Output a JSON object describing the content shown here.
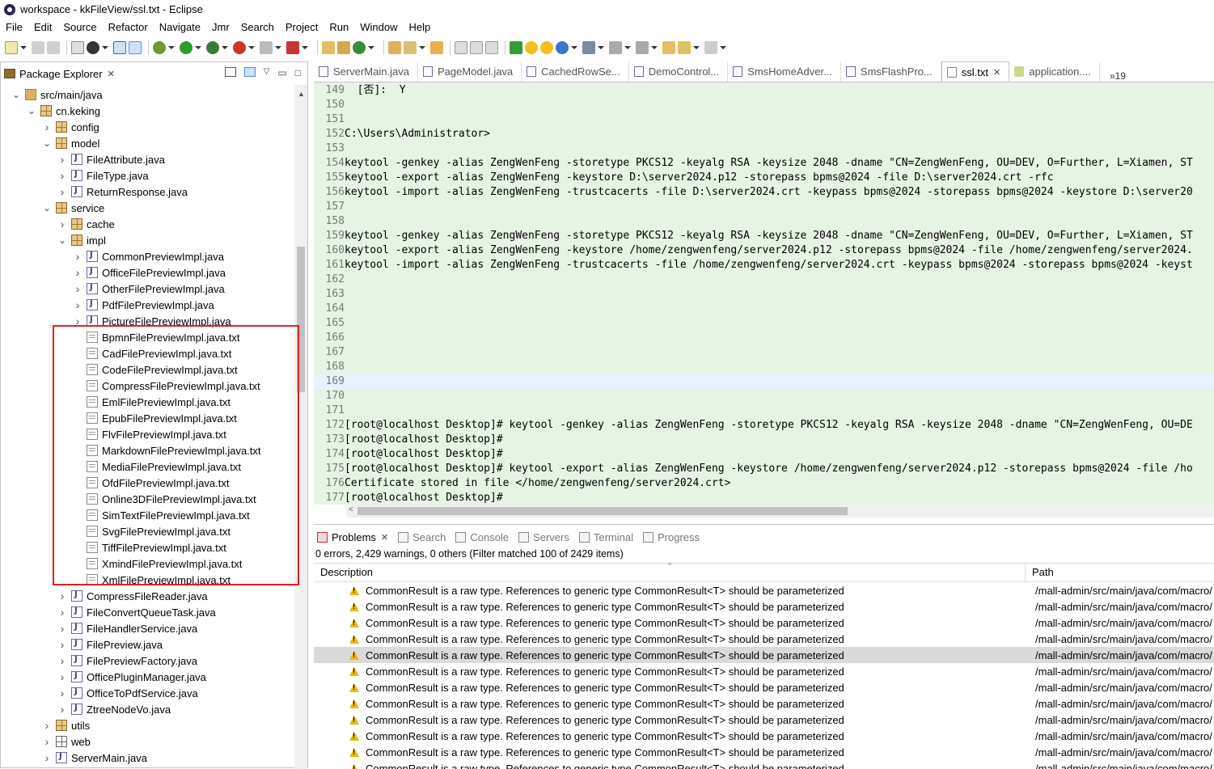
{
  "window": {
    "title": "workspace - kkFileView/ssl.txt - Eclipse"
  },
  "menu": [
    "File",
    "Edit",
    "Source",
    "Refactor",
    "Navigate",
    "Jmr",
    "Search",
    "Project",
    "Run",
    "Window",
    "Help"
  ],
  "explorer": {
    "title": "Package Explorer",
    "tree": [
      {
        "depth": 1,
        "expanded": true,
        "icon": "folder",
        "label": "src/main/java"
      },
      {
        "depth": 2,
        "expanded": true,
        "icon": "pkg",
        "label": "cn.keking"
      },
      {
        "depth": 3,
        "expanded": false,
        "icon": "pkg",
        "label": "config"
      },
      {
        "depth": 3,
        "expanded": true,
        "icon": "pkg",
        "label": "model"
      },
      {
        "depth": 4,
        "expanded": false,
        "icon": "java",
        "label": "FileAttribute.java"
      },
      {
        "depth": 4,
        "expanded": false,
        "icon": "java",
        "label": "FileType.java"
      },
      {
        "depth": 4,
        "expanded": false,
        "icon": "java",
        "label": "ReturnResponse.java"
      },
      {
        "depth": 3,
        "expanded": true,
        "icon": "pkg",
        "label": "service"
      },
      {
        "depth": 4,
        "expanded": false,
        "icon": "pkg",
        "label": "cache"
      },
      {
        "depth": 4,
        "expanded": true,
        "icon": "pkg",
        "label": "impl"
      },
      {
        "depth": 5,
        "expanded": false,
        "icon": "java",
        "label": "CommonPreviewImpl.java"
      },
      {
        "depth": 5,
        "expanded": false,
        "icon": "java",
        "label": "OfficeFilePreviewImpl.java"
      },
      {
        "depth": 5,
        "expanded": false,
        "icon": "java",
        "label": "OtherFilePreviewImpl.java"
      },
      {
        "depth": 5,
        "expanded": false,
        "icon": "java",
        "label": "PdfFilePreviewImpl.java"
      },
      {
        "depth": 5,
        "expanded": false,
        "icon": "java",
        "label": "PictureFilePreviewImpl.java"
      },
      {
        "depth": 5,
        "leaf": true,
        "icon": "txt",
        "label": "BpmnFilePreviewImpl.java.txt"
      },
      {
        "depth": 5,
        "leaf": true,
        "icon": "txt",
        "label": "CadFilePreviewImpl.java.txt"
      },
      {
        "depth": 5,
        "leaf": true,
        "icon": "txt",
        "label": "CodeFilePreviewImpl.java.txt"
      },
      {
        "depth": 5,
        "leaf": true,
        "icon": "txt",
        "label": "CompressFilePreviewImpl.java.txt"
      },
      {
        "depth": 5,
        "leaf": true,
        "icon": "txt",
        "label": "EmlFilePreviewImpl.java.txt"
      },
      {
        "depth": 5,
        "leaf": true,
        "icon": "txt",
        "label": "EpubFilePreviewImpl.java.txt"
      },
      {
        "depth": 5,
        "leaf": true,
        "icon": "txt",
        "label": "FlvFilePreviewImpl.java.txt"
      },
      {
        "depth": 5,
        "leaf": true,
        "icon": "txt",
        "label": "MarkdownFilePreviewImpl.java.txt"
      },
      {
        "depth": 5,
        "leaf": true,
        "icon": "txt",
        "label": "MediaFilePreviewImpl.java.txt"
      },
      {
        "depth": 5,
        "leaf": true,
        "icon": "txt",
        "label": "OfdFilePreviewImpl.java.txt"
      },
      {
        "depth": 5,
        "leaf": true,
        "icon": "txt",
        "label": "Online3DFilePreviewImpl.java.txt"
      },
      {
        "depth": 5,
        "leaf": true,
        "icon": "txt",
        "label": "SimTextFilePreviewImpl.java.txt"
      },
      {
        "depth": 5,
        "leaf": true,
        "icon": "txt",
        "label": "SvgFilePreviewImpl.java.txt"
      },
      {
        "depth": 5,
        "leaf": true,
        "icon": "txt",
        "label": "TiffFilePreviewImpl.java.txt"
      },
      {
        "depth": 5,
        "leaf": true,
        "icon": "txt",
        "label": "XmindFilePreviewImpl.java.txt"
      },
      {
        "depth": 5,
        "leaf": true,
        "icon": "txt",
        "label": "XmlFilePreviewImpl.java.txt"
      },
      {
        "depth": 4,
        "expanded": false,
        "icon": "java",
        "label": "CompressFileReader.java"
      },
      {
        "depth": 4,
        "expanded": false,
        "icon": "java",
        "label": "FileConvertQueueTask.java"
      },
      {
        "depth": 4,
        "expanded": false,
        "icon": "java",
        "label": "FileHandlerService.java"
      },
      {
        "depth": 4,
        "expanded": false,
        "icon": "java",
        "label": "FilePreview.java"
      },
      {
        "depth": 4,
        "expanded": false,
        "icon": "java",
        "label": "FilePreviewFactory.java"
      },
      {
        "depth": 4,
        "expanded": false,
        "icon": "java",
        "label": "OfficePluginManager.java"
      },
      {
        "depth": 4,
        "expanded": false,
        "icon": "java",
        "label": "OfficeToPdfService.java"
      },
      {
        "depth": 4,
        "expanded": false,
        "icon": "java",
        "label": "ZtreeNodeVo.java"
      },
      {
        "depth": 3,
        "expanded": false,
        "icon": "pkg",
        "label": "utils"
      },
      {
        "depth": 3,
        "expanded": false,
        "icon": "web",
        "label": "web"
      },
      {
        "depth": 3,
        "expanded": false,
        "icon": "java",
        "label": "ServerMain.java"
      }
    ]
  },
  "editor": {
    "tabs": [
      {
        "label": "ServerMain.java",
        "icon": "java"
      },
      {
        "label": "PageModel.java",
        "icon": "java"
      },
      {
        "label": "CachedRowSe...",
        "icon": "java"
      },
      {
        "label": "DemoControl...",
        "icon": "java"
      },
      {
        "label": "SmsHomeAdver...",
        "icon": "java"
      },
      {
        "label": "SmsFlashPro...",
        "icon": "java"
      },
      {
        "label": "ssl.txt",
        "icon": "txt",
        "active": true
      },
      {
        "label": "application....",
        "icon": "props"
      }
    ],
    "more": "»19",
    "lines": [
      {
        "n": "149",
        "t": "  [否]:  Y"
      },
      {
        "n": "150",
        "t": ""
      },
      {
        "n": "151",
        "t": ""
      },
      {
        "n": "152",
        "t": "C:\\Users\\Administrator>"
      },
      {
        "n": "153",
        "t": ""
      },
      {
        "n": "154",
        "t": "keytool -genkey -alias ZengWenFeng -storetype PKCS12 -keyalg RSA -keysize 2048 -dname \"CN=ZengWenFeng, OU=DEV, O=Further, L=Xiamen, ST"
      },
      {
        "n": "155",
        "t": "keytool -export -alias ZengWenFeng -keystore D:\\server2024.p12 -storepass bpms@2024 -file D:\\server2024.crt -rfc"
      },
      {
        "n": "156",
        "t": "keytool -import -alias ZengWenFeng -trustcacerts -file D:\\server2024.crt -keypass bpms@2024 -storepass bpms@2024 -keystore D:\\server20"
      },
      {
        "n": "157",
        "t": ""
      },
      {
        "n": "158",
        "t": ""
      },
      {
        "n": "159",
        "t": "keytool -genkey -alias ZengWenFeng -storetype PKCS12 -keyalg RSA -keysize 2048 -dname \"CN=ZengWenFeng, OU=DEV, O=Further, L=Xiamen, ST"
      },
      {
        "n": "160",
        "t": "keytool -export -alias ZengWenFeng -keystore /home/zengwenfeng/server2024.p12 -storepass bpms@2024 -file /home/zengwenfeng/server2024."
      },
      {
        "n": "161",
        "t": "keytool -import -alias ZengWenFeng -trustcacerts -file /home/zengwenfeng/server2024.crt -keypass bpms@2024 -storepass bpms@2024 -keyst"
      },
      {
        "n": "162",
        "t": ""
      },
      {
        "n": "163",
        "t": ""
      },
      {
        "n": "164",
        "t": ""
      },
      {
        "n": "165",
        "t": ""
      },
      {
        "n": "166",
        "t": ""
      },
      {
        "n": "167",
        "t": ""
      },
      {
        "n": "168",
        "t": ""
      },
      {
        "n": "169",
        "t": "",
        "current": true
      },
      {
        "n": "170",
        "t": ""
      },
      {
        "n": "171",
        "t": ""
      },
      {
        "n": "172",
        "t": "[root@localhost Desktop]# keytool -genkey -alias ZengWenFeng -storetype PKCS12 -keyalg RSA -keysize 2048 -dname \"CN=ZengWenFeng, OU=DE"
      },
      {
        "n": "173",
        "t": "[root@localhost Desktop]#"
      },
      {
        "n": "174",
        "t": "[root@localhost Desktop]#"
      },
      {
        "n": "175",
        "t": "[root@localhost Desktop]# keytool -export -alias ZengWenFeng -keystore /home/zengwenfeng/server2024.p12 -storepass bpms@2024 -file /ho"
      },
      {
        "n": "176",
        "t": "Certificate stored in file </home/zengwenfeng/server2024.crt>"
      },
      {
        "n": "177",
        "t": "[root@localhost Desktop]#"
      }
    ]
  },
  "bottom": {
    "tabs": [
      "Problems",
      "Search",
      "Console",
      "Servers",
      "Terminal",
      "Progress"
    ],
    "summary": "0 errors, 2,429 warnings, 0 others (Filter matched 100 of 2429 items)",
    "columns": {
      "description": "Description",
      "path": "Path"
    },
    "rows": [
      {
        "d": "CommonResult is a raw type. References to generic type CommonResult<T> should be parameterized",
        "p": "/mall-admin/src/main/java/com/macro/"
      },
      {
        "d": "CommonResult is a raw type. References to generic type CommonResult<T> should be parameterized",
        "p": "/mall-admin/src/main/java/com/macro/"
      },
      {
        "d": "CommonResult is a raw type. References to generic type CommonResult<T> should be parameterized",
        "p": "/mall-admin/src/main/java/com/macro/"
      },
      {
        "d": "CommonResult is a raw type. References to generic type CommonResult<T> should be parameterized",
        "p": "/mall-admin/src/main/java/com/macro/"
      },
      {
        "d": "CommonResult is a raw type. References to generic type CommonResult<T> should be parameterized",
        "p": "/mall-admin/src/main/java/com/macro/",
        "selected": true
      },
      {
        "d": "CommonResult is a raw type. References to generic type CommonResult<T> should be parameterized",
        "p": "/mall-admin/src/main/java/com/macro/"
      },
      {
        "d": "CommonResult is a raw type. References to generic type CommonResult<T> should be parameterized",
        "p": "/mall-admin/src/main/java/com/macro/"
      },
      {
        "d": "CommonResult is a raw type. References to generic type CommonResult<T> should be parameterized",
        "p": "/mall-admin/src/main/java/com/macro/"
      },
      {
        "d": "CommonResult is a raw type. References to generic type CommonResult<T> should be parameterized",
        "p": "/mall-admin/src/main/java/com/macro/"
      },
      {
        "d": "CommonResult is a raw type. References to generic type CommonResult<T> should be parameterized",
        "p": "/mall-admin/src/main/java/com/macro/"
      },
      {
        "d": "CommonResult is a raw type. References to generic type CommonResult<T> should be parameterized",
        "p": "/mall-admin/src/main/java/com/macro/"
      },
      {
        "d": "CommonResult is a raw type. References to generic type CommonResult<T> should be parameterized",
        "p": "/mall-admin/src/main/java/com/macro/"
      }
    ]
  },
  "colors": {
    "editor_bg": "#e6f4e4",
    "current_line": "#e8f2fe",
    "highlight_box": "#e02020",
    "selected_row": "#dadada"
  }
}
